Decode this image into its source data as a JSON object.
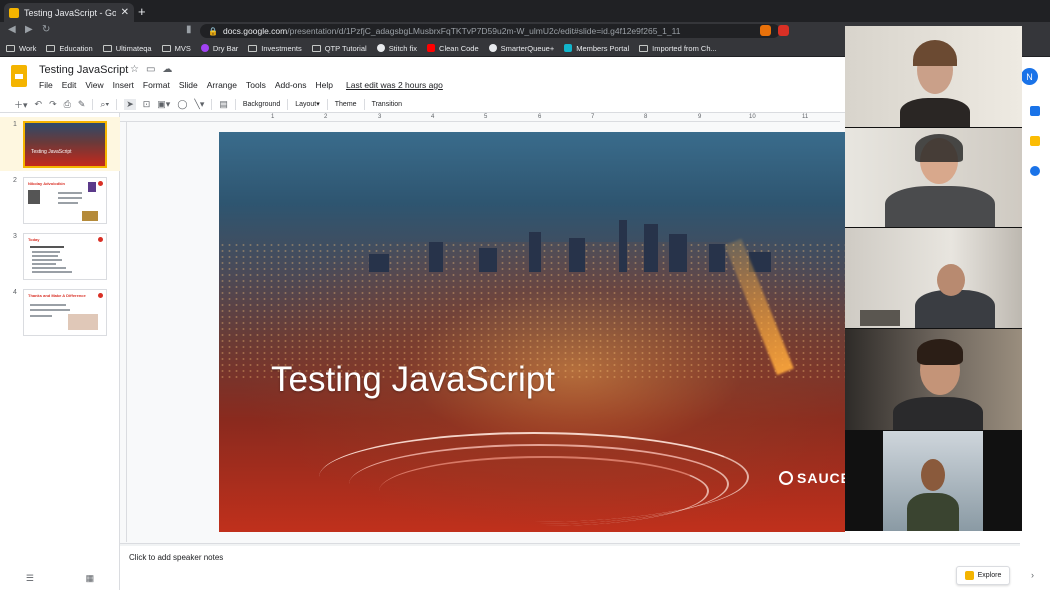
{
  "browser": {
    "tab_title": "Testing JavaScript - Google Slides",
    "url_host": "docs.google.com",
    "url_path": "/presentation/d/1PzfjC_adagsbgLMusbrxFqTKTvP7D59u2m-W_ulmU2c/edit#slide=id.g4f12e9f265_1_11",
    "bookmarks": [
      "Work",
      "Education",
      "Ultimateqa",
      "MVS",
      "Dry Bar",
      "Investments",
      "QTP Tutorial",
      "Stitch fix",
      "Clean Code",
      "SmarterQueue+",
      "Members Portal",
      "Imported from Ch..."
    ]
  },
  "app": {
    "title": "Testing JavaScript",
    "menus": [
      "File",
      "Edit",
      "View",
      "Insert",
      "Format",
      "Slide",
      "Arrange",
      "Tools",
      "Add-ons",
      "Help"
    ],
    "last_edit": "Last edit was 2 hours ago",
    "avatar_initial": "N"
  },
  "toolbar": {
    "background": "Background",
    "layout": "Layout",
    "theme": "Theme",
    "transition": "Transition"
  },
  "ruler": [
    "1",
    "2",
    "3",
    "4",
    "5",
    "6",
    "7",
    "8",
    "9",
    "10",
    "11"
  ],
  "slides": [
    {
      "number": "1",
      "title": "Testing JavaScript"
    },
    {
      "number": "2",
      "title": "Nikolay Advolodkin"
    },
    {
      "number": "3",
      "title": "Today"
    },
    {
      "number": "4",
      "title": "Thanks and Make A Difference"
    }
  ],
  "current_slide": {
    "title": "Testing JavaScript",
    "logo_text": "SAUCE"
  },
  "notes_placeholder": "Click to add speaker notes",
  "explore_label": "Explore",
  "colors": {
    "slides_yellow": "#f4b400",
    "accent_blue": "#1a73e8",
    "chrome_dark": "#202124",
    "tile_highlight": "#c9b646"
  }
}
